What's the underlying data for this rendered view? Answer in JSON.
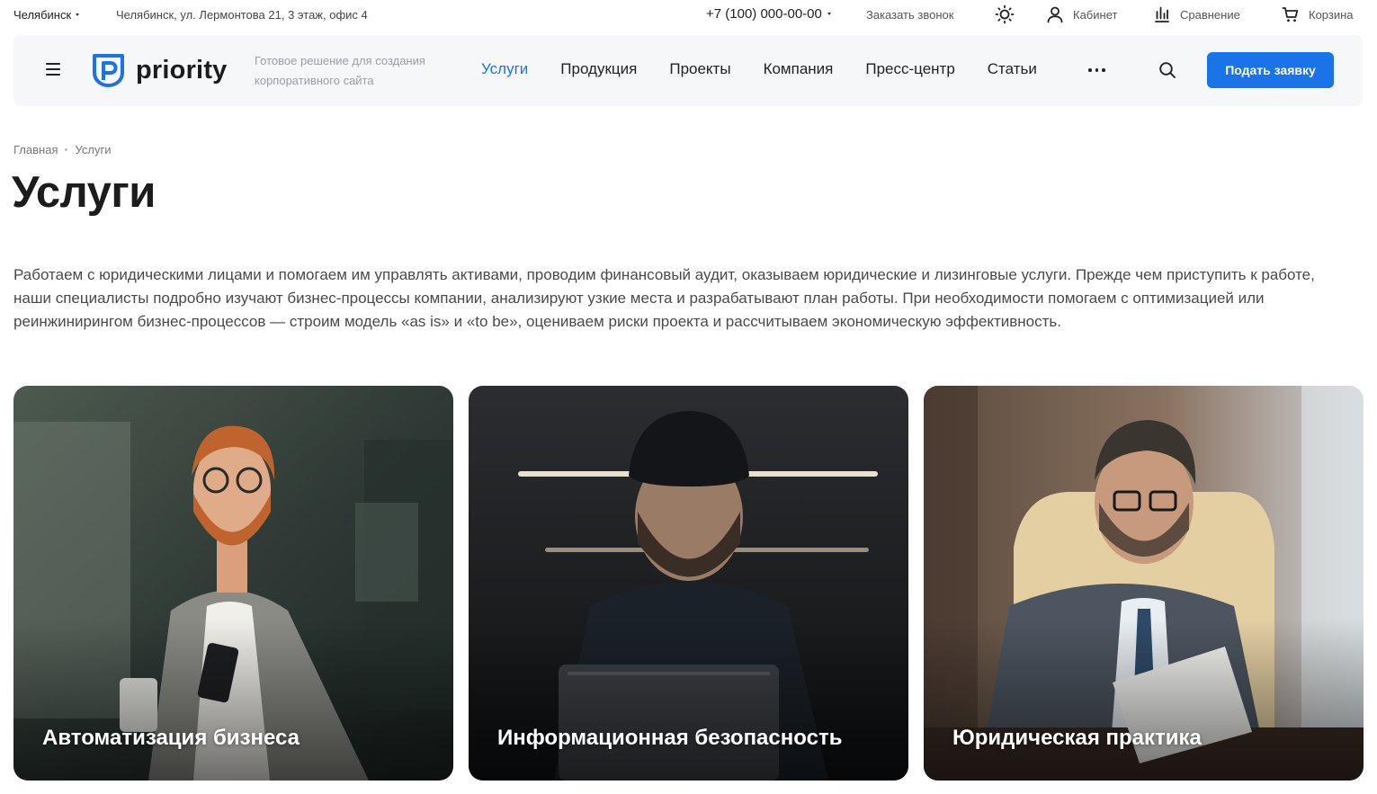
{
  "topbar": {
    "city": "Челябинск",
    "address": "Челябинск, ул. Лермонтова 21, 3 этаж, офис 4",
    "phone": "+7 (100) 000-00-00",
    "callback": "Заказать звонок",
    "cabinet": "Кабинет",
    "compare": "Сравнение",
    "cart": "Корзина"
  },
  "header": {
    "logo_text": "priority",
    "tagline": "Готовое решение для создания корпоративного сайта",
    "nav": [
      "Услуги",
      "Продукция",
      "Проекты",
      "Компания",
      "Пресс-центр",
      "Статьи"
    ],
    "active_nav": "Услуги",
    "apply_button": "Подать заявку"
  },
  "breadcrumb": [
    "Главная",
    "Услуги"
  ],
  "page": {
    "title": "Услуги",
    "intro": "Работаем с юридическими лицами и помогаем им управлять активами, проводим финансовый аудит, оказываем юридические и лизинговые услуги. Прежде чем приступить к работе, наши специалисты подробно изучают бизнес-процессы компании, анализируют узкие места и разрабатывают план работы. При необходимости помогаем с оптимизацией или реинжинирингом бизнес-процессов — строим модель «as is» и «to be», оцениваем риски проекта и рассчитываем экономическую эффективность."
  },
  "cards": [
    {
      "title": "Автоматизация бизнеса"
    },
    {
      "title": "Информационная безопасность"
    },
    {
      "title": "Юридическая практика"
    }
  ],
  "colors": {
    "accent": "#1a73e8",
    "header_bg": "#f6f7f9",
    "text": "#1c1c1c"
  },
  "icons": [
    "chevron-down-icon",
    "sun-icon",
    "user-icon",
    "chart-bars-icon",
    "cart-icon",
    "menu-icon",
    "search-icon",
    "more-dots-icon",
    "logo-icon"
  ]
}
